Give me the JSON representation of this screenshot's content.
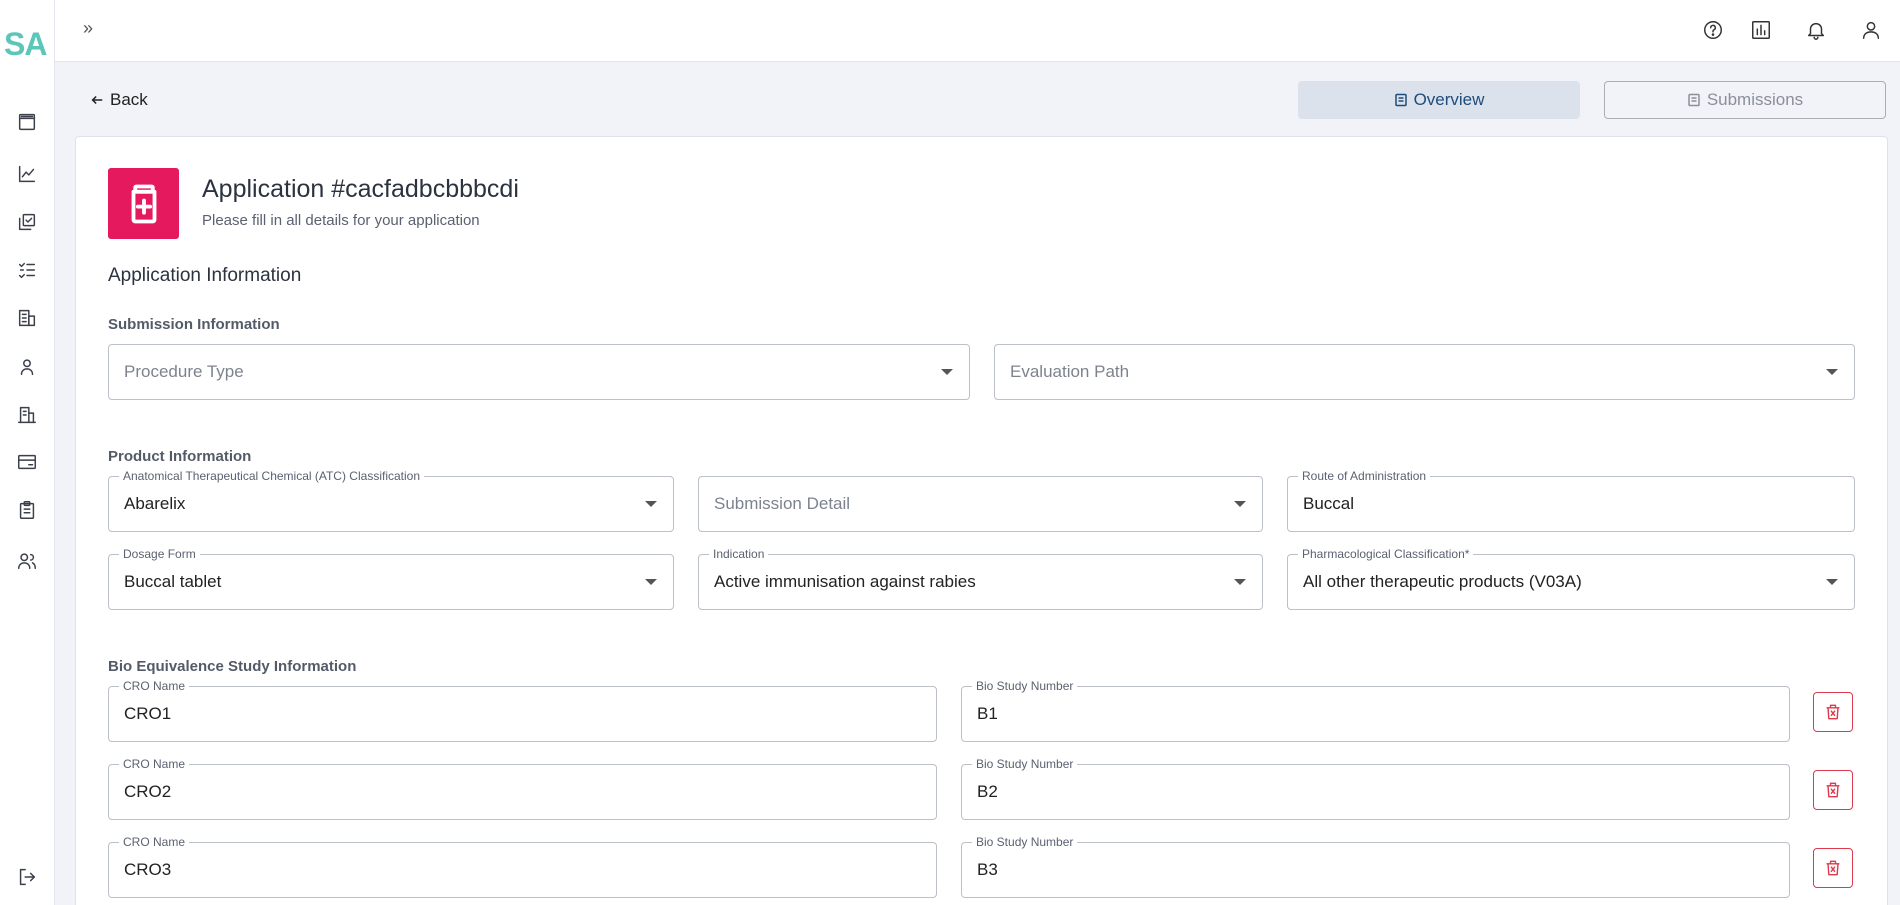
{
  "brand": {
    "logo": "SA",
    "accent": "#5cc6b8"
  },
  "sidebar": {
    "items": [
      {
        "icon": "book-icon"
      },
      {
        "icon": "chart-line-icon"
      },
      {
        "icon": "copy-check-icon"
      },
      {
        "icon": "list-check-icon"
      },
      {
        "icon": "building-grid-icon"
      },
      {
        "icon": "user-icon"
      },
      {
        "icon": "building-icon"
      },
      {
        "icon": "card-icon"
      },
      {
        "icon": "clipboard-icon"
      },
      {
        "icon": "users-icon"
      }
    ],
    "logout_icon": "logout-icon"
  },
  "topbar": {
    "expand": "»",
    "icons": [
      "help-icon",
      "report-icon",
      "bell-icon",
      "user-icon"
    ]
  },
  "nav": {
    "back_label": "Back",
    "overview_label": "Overview",
    "submissions_label": "Submissions"
  },
  "application": {
    "title": "Application #cacfadbcbbbcdi",
    "subtitle": "Please fill in all details for your application",
    "icon_color": "#e5195e"
  },
  "section_title": "Application Information",
  "submission_info": {
    "label": "Submission Information",
    "procedure_type_placeholder": "Procedure Type",
    "evaluation_path_placeholder": "Evaluation Path"
  },
  "product_info": {
    "label": "Product Information",
    "atc": {
      "label": "Anatomical Therapeutical Chemical (ATC) Classification",
      "value": "Abarelix"
    },
    "submission_detail_placeholder": "Submission Detail",
    "route": {
      "label": "Route of Administration",
      "value": "Buccal"
    },
    "dosage_form": {
      "label": "Dosage Form",
      "value": "Buccal tablet"
    },
    "indication": {
      "label": "Indication",
      "value": "Active immunisation against rabies"
    },
    "pharma_class": {
      "label": "Pharmacological Classification*",
      "value": "All other therapeutic products (V03A)"
    }
  },
  "bio_study": {
    "label": "Bio Equivalence Study Information",
    "rows": [
      {
        "cro_label": "CRO Name",
        "cro_value": "CRO1",
        "bio_label": "Bio Study Number",
        "bio_value": "B1"
      },
      {
        "cro_label": "CRO Name",
        "cro_value": "CRO2",
        "bio_label": "Bio Study Number",
        "bio_value": "B2"
      },
      {
        "cro_label": "CRO Name",
        "cro_value": "CRO3",
        "bio_label": "Bio Study Number",
        "bio_value": "B3"
      }
    ],
    "delete_color": "#dd3a4d"
  }
}
